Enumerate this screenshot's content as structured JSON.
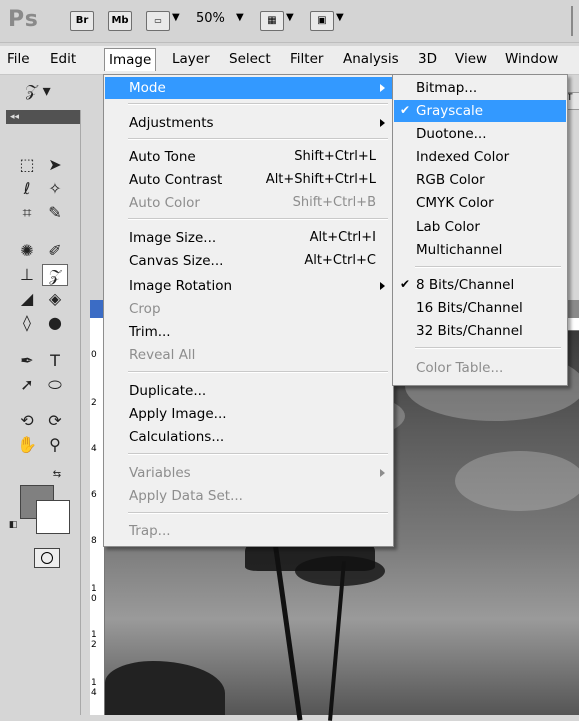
{
  "appbar": {
    "logo": "Ps",
    "bridge_label": "Br",
    "minibridge_label": "Mb",
    "zoom": "50%"
  },
  "menubar": {
    "items": [
      "File",
      "Edit",
      "Image",
      "Layer",
      "Select",
      "Filter",
      "Analysis",
      "3D",
      "View",
      "Window"
    ],
    "active": "Image"
  },
  "image_menu": {
    "items": [
      {
        "label": "Mode",
        "submenu": true,
        "highlighted": true
      },
      {
        "label": "Adjustments",
        "submenu": true
      },
      {
        "label": "Auto Tone",
        "shortcut": "Shift+Ctrl+L"
      },
      {
        "label": "Auto Contrast",
        "shortcut": "Alt+Shift+Ctrl+L"
      },
      {
        "label": "Auto Color",
        "shortcut": "Shift+Ctrl+B",
        "disabled": true
      },
      {
        "label": "Image Size...",
        "shortcut": "Alt+Ctrl+I"
      },
      {
        "label": "Canvas Size...",
        "shortcut": "Alt+Ctrl+C"
      },
      {
        "label": "Image Rotation",
        "submenu": true
      },
      {
        "label": "Crop",
        "disabled": true
      },
      {
        "label": "Trim..."
      },
      {
        "label": "Reveal All",
        "disabled": true
      },
      {
        "label": "Duplicate..."
      },
      {
        "label": "Apply Image..."
      },
      {
        "label": "Calculations..."
      },
      {
        "label": "Variables",
        "submenu": true,
        "disabled": true
      },
      {
        "label": "Apply Data Set...",
        "disabled": true
      },
      {
        "label": "Trap...",
        "disabled": true
      }
    ]
  },
  "mode_submenu": {
    "items": [
      {
        "label": "Bitmap..."
      },
      {
        "label": "Grayscale",
        "checked": true,
        "highlighted": true
      },
      {
        "label": "Duotone..."
      },
      {
        "label": "Indexed Color"
      },
      {
        "label": "RGB Color"
      },
      {
        "label": "CMYK Color"
      },
      {
        "label": "Lab Color"
      },
      {
        "label": "Multichannel"
      },
      {
        "label": "8 Bits/Channel",
        "checked": true
      },
      {
        "label": "16 Bits/Channel"
      },
      {
        "label": "32 Bits/Channel"
      },
      {
        "label": "Color Table...",
        "disabled": true
      }
    ]
  },
  "ruler": {
    "vertical_labels": [
      "0",
      "2",
      "4",
      "6",
      "8",
      "1 0",
      "1 2",
      "1 4"
    ]
  },
  "colors": {
    "highlight": "#3399ff",
    "foreground_swatch": "#808080",
    "background_swatch": "#ffffff"
  }
}
